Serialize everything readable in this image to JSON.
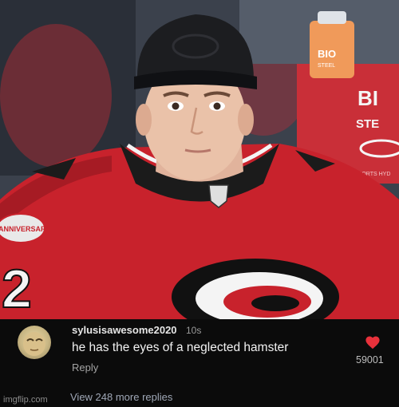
{
  "photo": {
    "description_icon": "photo-of-hockey-player",
    "bottle_label": "BIO\nSTEEL",
    "sign_text": "BI\nSTE",
    "sign_small": "SPORTS HYD",
    "patch_text": "ANNIVERSARY",
    "jersey_number": "2"
  },
  "comment": {
    "username": "sylusisawesome2020",
    "timestamp": "10s",
    "text": "he has the eyes of a neglected hamster",
    "reply_label": "Reply",
    "like_count": "59001",
    "liked": true,
    "heart_color": "#e8313b",
    "view_replies_label": "View 248 more replies"
  },
  "watermark": "imgflip.com"
}
